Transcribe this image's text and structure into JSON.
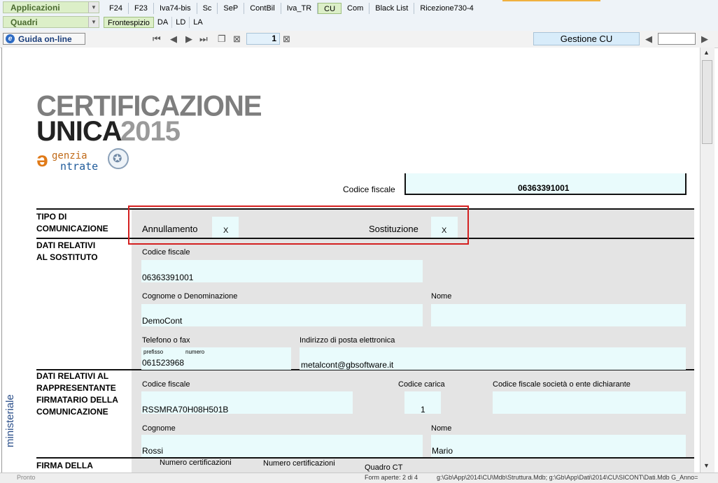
{
  "menus": {
    "applicazioni": "Applicazioni",
    "quadri": "Quadri"
  },
  "tabs_main": [
    "F24",
    "F23",
    "Iva74-bis",
    "Sc",
    "SeP",
    "ContBil",
    "Iva_TR",
    "CU",
    "Com",
    "Black List",
    "Ricezione730-4"
  ],
  "tabs_sub": [
    "Frontespizio",
    "DA",
    "LD",
    "LA"
  ],
  "toolbar": {
    "guida_label": "Guida on-line",
    "page_number": "1",
    "gestione_label": "Gestione CU"
  },
  "logo": {
    "line1": "CERTIFICAZIONE",
    "line2a": "UNICA",
    "line2b": "2015",
    "agenzia": "genzia",
    "entrate": "ntrate"
  },
  "header": {
    "codice_fiscale_label": "Codice fiscale",
    "codice_fiscale_value": "06363391001"
  },
  "tipo_comunicazione": {
    "section": [
      "TIPO DI",
      "COMUNICAZIONE"
    ],
    "annullamento_label": "Annullamento",
    "annullamento_value": "X",
    "sostituzione_label": "Sostituzione",
    "sostituzione_value": "X"
  },
  "sostituto": {
    "section": [
      "DATI RELATIVI",
      "AL SOSTITUTO"
    ],
    "cf_label": "Codice fiscale",
    "cf_value": "06363391001",
    "cognome_label": "Cognome o Denominazione",
    "cognome_value": "DemoCont",
    "nome_label": "Nome",
    "nome_value": "",
    "telefono_label": "Telefono o fax",
    "prefisso_label": "prefisso",
    "numero_label": "numero",
    "telefono_value": "061523968",
    "email_label": "Indirizzo di posta elettronica",
    "email_value": "metalcont@gbsoftware.it"
  },
  "rappresentante": {
    "section": [
      "DATI RELATIVI AL",
      "RAPPRESENTANTE",
      "FIRMATARIO DELLA",
      "COMUNICAZIONE"
    ],
    "cf_label": "Codice fiscale",
    "cf_value": "RSSMRA70H08H501B",
    "carica_label": "Codice carica",
    "carica_value": "1",
    "cf_societa_label": "Codice fiscale società o ente dichiarante",
    "cf_societa_value": "",
    "cognome_label": "Cognome",
    "cognome_value": "Rossi",
    "nome_label": "Nome",
    "nome_value": "Mario"
  },
  "firma": {
    "section": "FIRMA DELLA",
    "num_cert_1": "Numero certificazioni",
    "num_cert_2": "Numero certificazioni",
    "quadro_ct": "Quadro CT"
  },
  "side_label": "ministeriale",
  "status": {
    "left": "Pronto",
    "forms": "Form aperte: 2 di 4",
    "path": "g:\\Gb\\App\\2014\\CU\\Mdb\\Struttura.Mdb; g:\\Gb\\App\\Dati\\2014\\CU\\SICONT\\Dati.Mdb G_Anno="
  },
  "colors": {
    "field_bg": "#e9fbfc",
    "section_grey": "#e4e4e4",
    "highlight_red": "#d42020",
    "active_tab": "#dcefc8"
  }
}
